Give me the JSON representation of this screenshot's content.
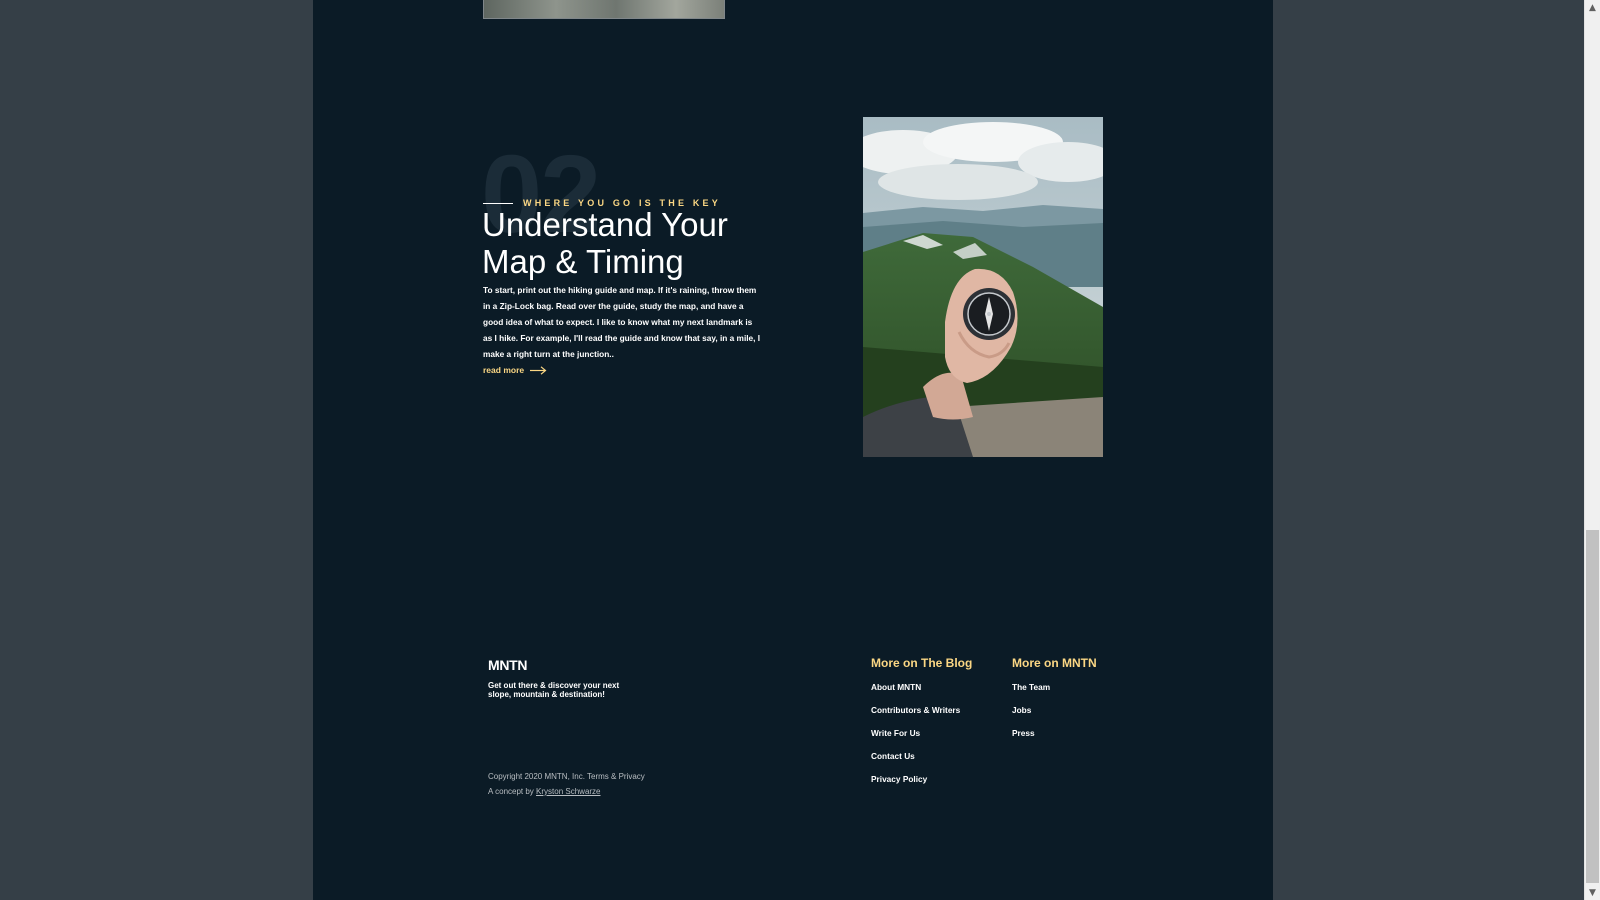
{
  "section": {
    "number": "02",
    "eyebrow": "WHERE YOU GO IS THE KEY",
    "title": "Understand Your Map & Timing",
    "body": "To start, print out the hiking guide and map. If it's raining, throw them in a Zip-Lock bag. Read over the guide, study the map, and have a good idea of what to expect. I like to know what my next landmark is as I hike. For example, I'll read the guide and know that say, in a mile, I make a right turn at the junction..",
    "read_more": "read more",
    "image_alt": "Hand holding a compass above a green mountain ridge"
  },
  "footer": {
    "logo": "MNTN",
    "tagline": "Get out there & discover your next slope, mountain & destination!",
    "copyright": "Copyright 2020 MNTN, Inc. Terms & Privacy",
    "concept_prefix": "A concept by ",
    "concept_author": "Kryston Schwarze",
    "blog": {
      "heading": "More on The Blog",
      "links": [
        "About MNTN",
        "Contributors & Writers",
        "Write For Us",
        "Contact Us",
        "Privacy Policy"
      ]
    },
    "mntn": {
      "heading": "More on MNTN",
      "links": [
        "The Team",
        "Jobs",
        "Press"
      ]
    }
  },
  "colors": {
    "page_background": "#0b1b26",
    "outer_background": "#353f47",
    "accent": "#fbd784",
    "text": "#ffffff"
  },
  "icons": [
    "arrow-right-icon",
    "scroll-up-icon",
    "scroll-down-icon"
  ]
}
